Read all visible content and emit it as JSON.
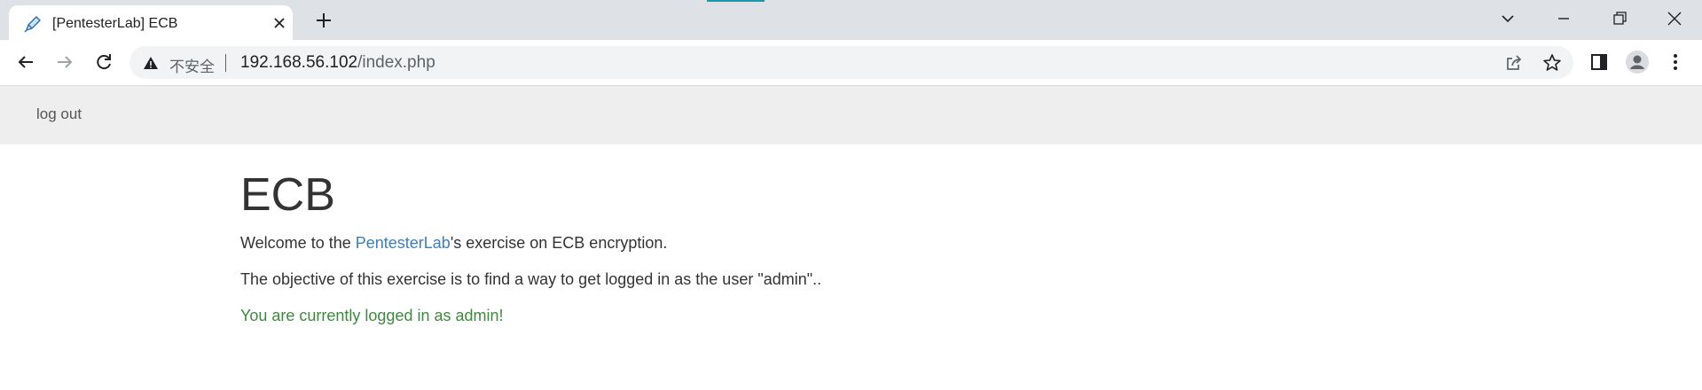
{
  "browser": {
    "tab_title": "[PentesterLab] ECB",
    "security_label": "不安全",
    "url_host": "192.168.56.102",
    "url_path": "/index.php"
  },
  "page": {
    "nav": {
      "logout_label": "log out"
    },
    "heading": "ECB",
    "intro_prefix": "Welcome to the ",
    "intro_link": "PentesterLab",
    "intro_suffix": "'s exercise on ECB encryption.",
    "objective": "The objective of this exercise is to find a way to get logged in as the user \"admin\"..",
    "status_message": "You are currently logged in as admin!"
  },
  "colors": {
    "link": "#3a7fc3",
    "success": "#3c8b3c",
    "navbar_bg": "#eeeeee",
    "tabstrip_bg": "#dee1e6"
  }
}
